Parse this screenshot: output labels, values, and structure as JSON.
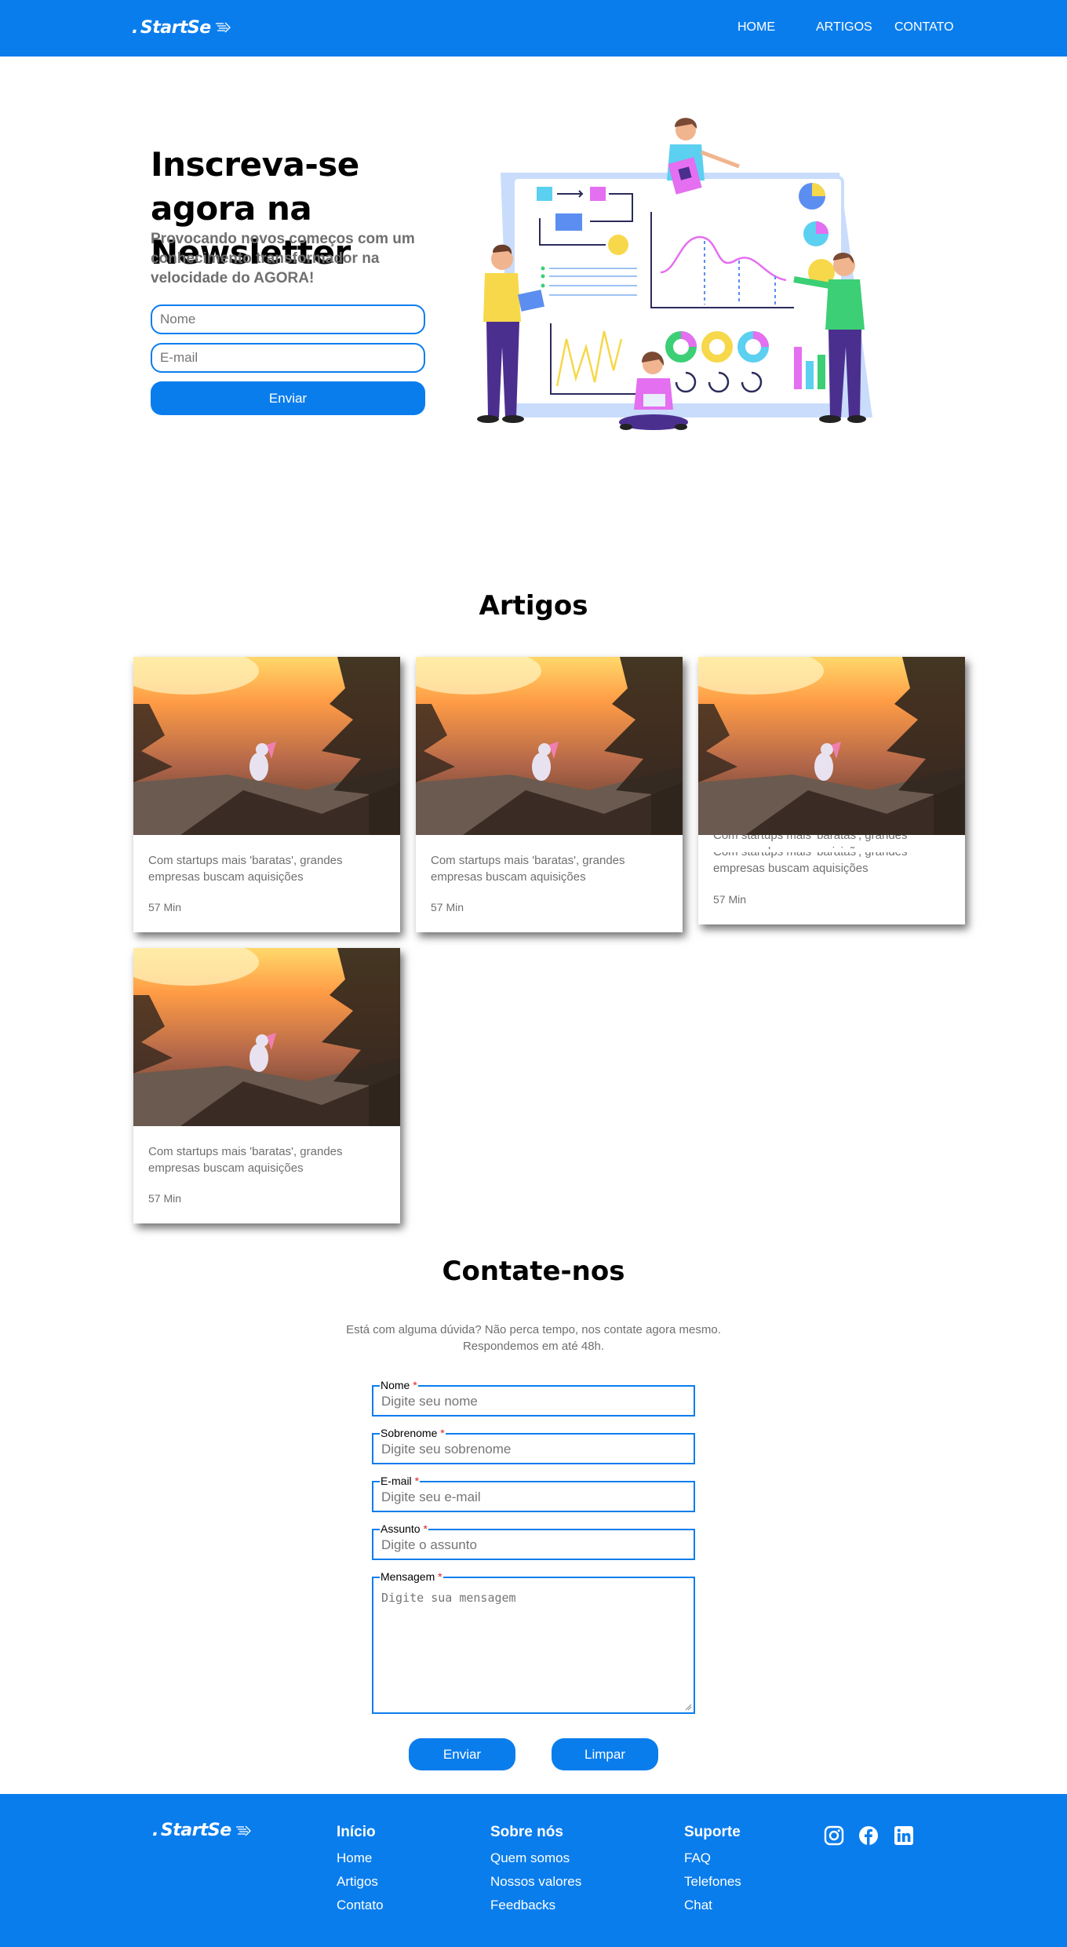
{
  "brand": {
    "logo_dot": ".",
    "logo_text": "StartSe",
    "color": "#0a7ded"
  },
  "header": {
    "nav": [
      {
        "label": "HOME"
      },
      {
        "label": "ARTIGOS"
      },
      {
        "label": "CONTATO"
      }
    ]
  },
  "hero": {
    "title": "Inscreva-se agora na Newsletter",
    "subtitle": "Provocando novos começos com um conhecimento transformador na velocidade do AGORA!",
    "name_placeholder": "Nome",
    "email_placeholder": "E-mail",
    "submit_label": "Enviar"
  },
  "articles": {
    "title": "Artigos",
    "cards": [
      {
        "text": "Com startups mais 'baratas', grandes empresas buscam aquisições",
        "time": "57 Min"
      },
      {
        "text": "Com startups mais 'baratas', grandes empresas buscam aquisições",
        "time": "57 Min"
      },
      {
        "text": "Com startups mais 'baratas', grandes empresas buscam aquisições",
        "time": "57 Min"
      },
      {
        "text": "Com startups mais 'baratas', grandes empresas buscam aquisições",
        "time": "57 Min"
      }
    ]
  },
  "contact": {
    "title": "Contate-nos",
    "description": "Está com alguma dúvida? Não perca tempo, nos contate agora mesmo. Respondemos em até 48h.",
    "required_mark": "*",
    "fields": [
      {
        "label": "Nome",
        "placeholder": "Digite seu nome"
      },
      {
        "label": "Sobrenome",
        "placeholder": "Digite seu sobrenome"
      },
      {
        "label": "E-mail",
        "placeholder": "Digite seu e-mail"
      },
      {
        "label": "Assunto",
        "placeholder": "Digite o assunto"
      },
      {
        "label": "Mensagem",
        "placeholder": "Digite sua mensagem"
      }
    ],
    "submit_label": "Enviar",
    "clear_label": "Limpar"
  },
  "footer": {
    "columns": [
      {
        "title": "Início",
        "links": [
          "Home",
          "Artigos",
          "Contato"
        ]
      },
      {
        "title": "Sobre nós",
        "links": [
          "Quem somos",
          "Nossos valores",
          "Feedbacks"
        ]
      },
      {
        "title": "Suporte",
        "links": [
          "FAQ",
          "Telefones",
          "Chat"
        ]
      }
    ],
    "social_icons": [
      "instagram-icon",
      "facebook-icon",
      "linkedin-icon"
    ]
  }
}
